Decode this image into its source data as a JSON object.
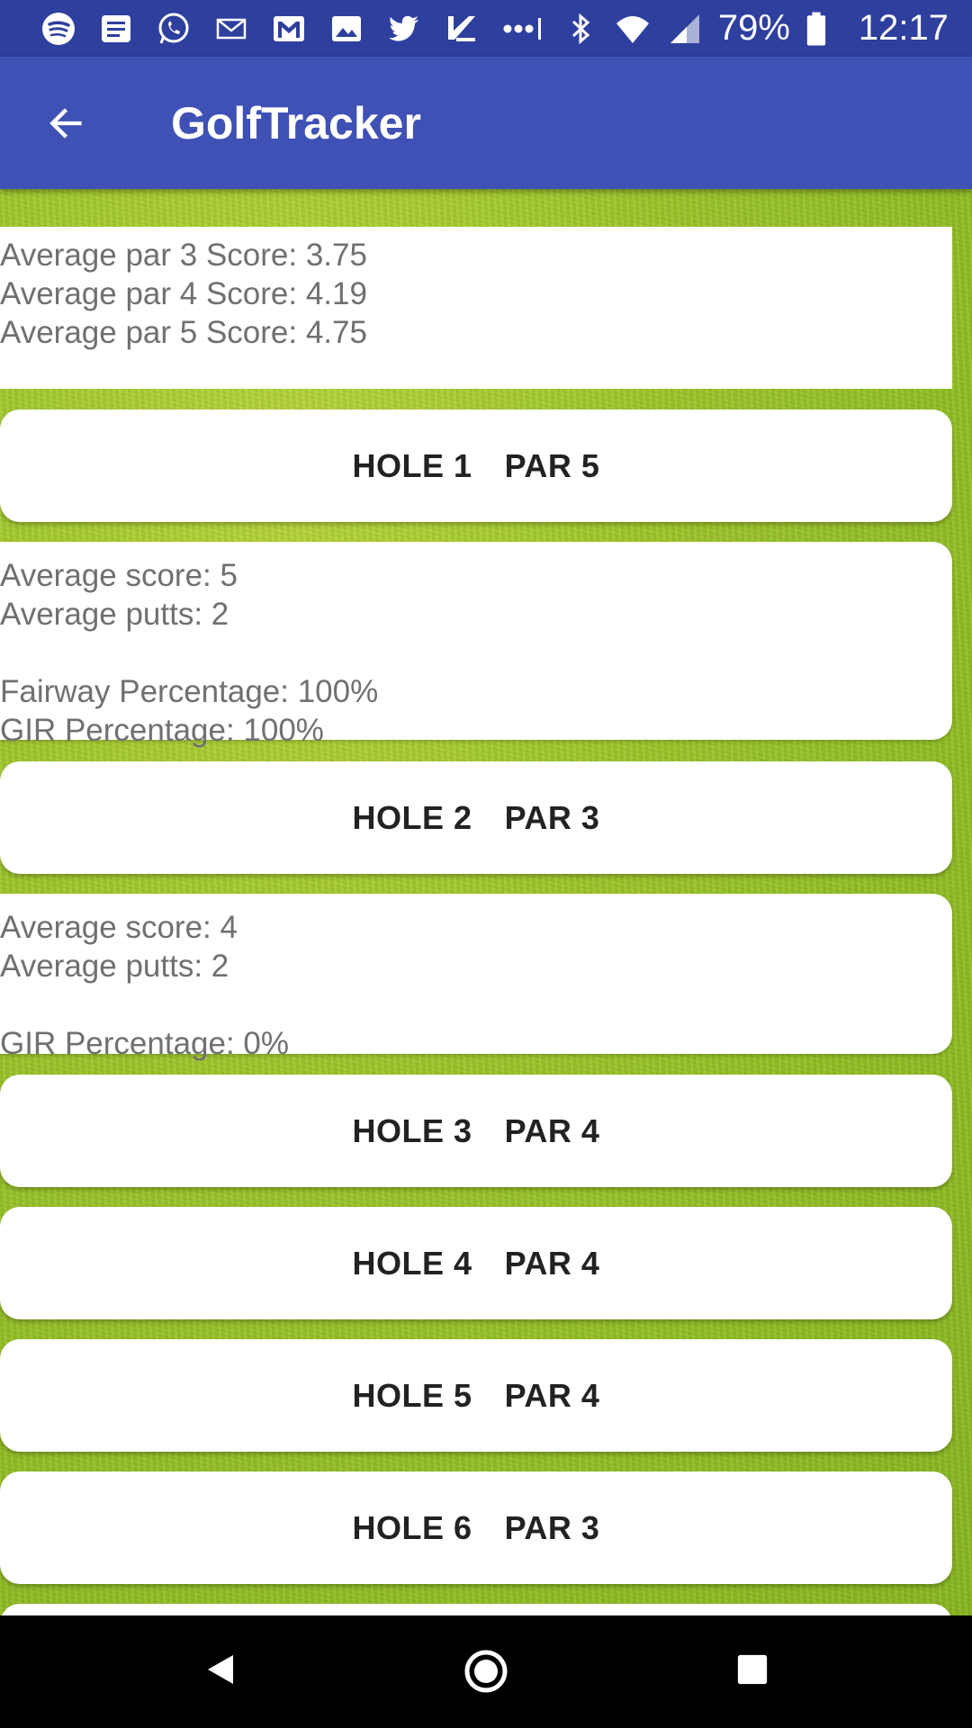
{
  "status_bar": {
    "icons": [
      "spotify-icon",
      "news-icon",
      "whatsapp-icon",
      "mail-icon",
      "gmail-icon",
      "photos-icon",
      "twitter-icon",
      "tasks-icon",
      "more-dots-icon"
    ],
    "battery": "79%",
    "time": "12:17"
  },
  "app_bar": {
    "title": "GolfTracker",
    "back_icon": "arrow-back-icon",
    "color": "#3f51b5"
  },
  "summary": {
    "par3": "Average par 3 Score: 3.75",
    "par4": "Average par 4 Score: 4.19",
    "par5": "Average par 5 Score: 4.75"
  },
  "holes": [
    {
      "hole": "HOLE 1",
      "par": "PAR 5",
      "details": {
        "avg_score": "Average score: 5",
        "avg_putts": "Average putts: 2",
        "fairway": "Fairway Percentage: 100%",
        "gir": "GIR Percentage: 100%"
      }
    },
    {
      "hole": "HOLE 2",
      "par": "PAR 3",
      "details": {
        "avg_score": "Average score: 4",
        "avg_putts": "Average putts: 2",
        "gir": "GIR Percentage: 0%"
      }
    },
    {
      "hole": "HOLE 3",
      "par": "PAR 4"
    },
    {
      "hole": "HOLE 4",
      "par": "PAR 4"
    },
    {
      "hole": "HOLE 5",
      "par": "PAR 4"
    },
    {
      "hole": "HOLE 6",
      "par": "PAR 3"
    }
  ],
  "nav_bar": {
    "back": "nav-back-icon",
    "home": "nav-home-icon",
    "recents": "nav-recents-icon"
  }
}
